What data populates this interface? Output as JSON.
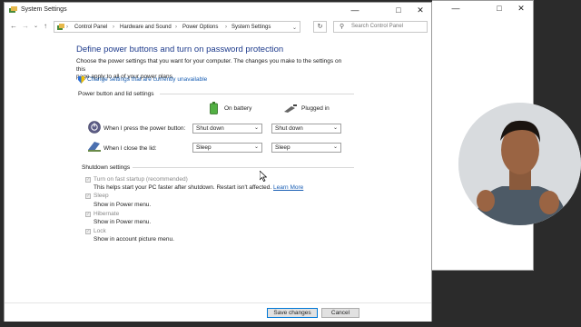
{
  "window": {
    "title": "System Settings"
  },
  "address_bar": {
    "breadcrumbs": [
      "Control Panel",
      "Hardware and Sound",
      "Power Options",
      "System Settings"
    ],
    "search_placeholder": "Search Control Panel"
  },
  "page": {
    "heading": "Define power buttons and turn on password protection",
    "description_line1": "Choose the power settings that you want for your computer. The changes you make to the settings on this",
    "description_line2": "page apply to all of your power plans.",
    "change_settings_link": "Change settings that are currently unavailable"
  },
  "power_section": {
    "title": "Power button and lid settings",
    "col_battery": "On battery",
    "col_plugged": "Plugged in",
    "rows": [
      {
        "label": "When I press the power button:",
        "battery": "Shut down",
        "plugged": "Shut down"
      },
      {
        "label": "When I close the lid:",
        "battery": "Sleep",
        "plugged": "Sleep"
      }
    ]
  },
  "shutdown_section": {
    "title": "Shutdown settings",
    "items": [
      {
        "label": "Turn on fast startup (recommended)",
        "desc": "This helps start your PC faster after shutdown. Restart isn't affected.",
        "link": "Learn More",
        "checked": true
      },
      {
        "label": "Sleep",
        "desc": "Show in Power menu.",
        "checked": true
      },
      {
        "label": "Hibernate",
        "desc": "Show in Power menu.",
        "checked": true
      },
      {
        "label": "Lock",
        "desc": "Show in account picture menu.",
        "checked": true
      }
    ]
  },
  "footer": {
    "save": "Save changes",
    "cancel": "Cancel"
  },
  "colors": {
    "heading": "#1e3b8c",
    "link": "#1a5fb4",
    "accent": "#0078d7"
  }
}
